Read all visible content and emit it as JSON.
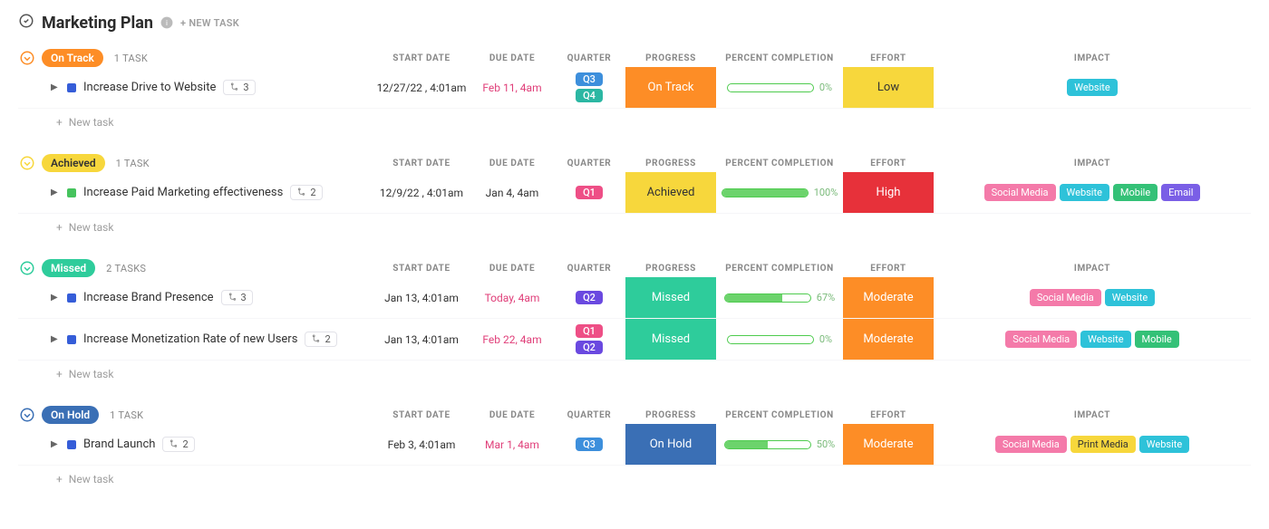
{
  "header": {
    "title": "Marketing Plan",
    "new_task_label": "+ NEW TASK"
  },
  "columns": {
    "start_date": "START DATE",
    "due_date": "DUE DATE",
    "quarter": "QUARTER",
    "progress": "PROGRESS",
    "percent": "PERCENT COMPLETION",
    "effort": "EFFORT",
    "impact": "IMPACT"
  },
  "colors": {
    "status": {
      "On Track": "#fd8d26",
      "Achieved": "#f7d73c",
      "Missed": "#2ecc9b",
      "On Hold": "#3a6fb5"
    },
    "status_text_dark": [
      "Achieved"
    ],
    "group_pill": {
      "On Track": "#fd8d26",
      "Achieved": "#f7d73c",
      "Missed": "#2ecc9b",
      "On Hold": "#3a6fb5"
    },
    "group_pill_text_dark": [
      "Achieved"
    ],
    "group_collapse": {
      "On Track": "#fd8d26",
      "Achieved": "#f7d73c",
      "Missed": "#2ecc9b",
      "On Hold": "#3a6fb5"
    },
    "effort": {
      "Low": "#f7d73c",
      "Moderate": "#fd8d26",
      "High": "#e7313a"
    },
    "effort_text_dark": [
      "Low"
    ],
    "quarter": {
      "Q1": "#ee4f86",
      "Q2": "#6a49e0",
      "Q3": "#3d8fdc",
      "Q4": "#2bb7a3"
    },
    "impact": {
      "Website": "#2ec2d9",
      "Social Media": "#f47aa9",
      "Mobile": "#34c177",
      "Email": "#7a5fe6",
      "Print Media": "#f7d73c"
    },
    "impact_text_dark": [
      "Print Media"
    ],
    "task_dot": {
      "blue": "#355dd8",
      "green": "#45c35d"
    }
  },
  "new_task_row_label": "+ New task",
  "groups": [
    {
      "name": "On Track",
      "count_label": "1 TASK",
      "tasks": [
        {
          "name": "Increase Drive to Website",
          "dot": "blue",
          "subtasks": 3,
          "start_date": "12/27/22 , 4:01am",
          "due_date": "Feb 11, 4am",
          "due_late": true,
          "quarters": [
            "Q3",
            "Q4"
          ],
          "progress": "On Track",
          "percent": 0,
          "effort": "Low",
          "impact": [
            "Website"
          ]
        }
      ]
    },
    {
      "name": "Achieved",
      "count_label": "1 TASK",
      "tasks": [
        {
          "name": "Increase Paid Marketing effectiveness",
          "dot": "green",
          "subtasks": 2,
          "start_date": "12/9/22 , 4:01am",
          "due_date": "Jan 4, 4am",
          "due_late": false,
          "quarters": [
            "Q1"
          ],
          "progress": "Achieved",
          "percent": 100,
          "effort": "High",
          "impact": [
            "Social Media",
            "Website",
            "Mobile",
            "Email"
          ]
        }
      ]
    },
    {
      "name": "Missed",
      "count_label": "2 TASKS",
      "tasks": [
        {
          "name": "Increase Brand Presence",
          "dot": "blue",
          "subtasks": 3,
          "start_date": "Jan 13, 4:01am",
          "due_date": "Today, 4am",
          "due_late": true,
          "quarters": [
            "Q2"
          ],
          "progress": "Missed",
          "percent": 67,
          "effort": "Moderate",
          "impact": [
            "Social Media",
            "Website"
          ]
        },
        {
          "name": "Increase Monetization Rate of new Users",
          "dot": "blue",
          "subtasks": 2,
          "start_date": "Jan 13, 4:01am",
          "due_date": "Feb 22, 4am",
          "due_late": true,
          "quarters": [
            "Q1",
            "Q2"
          ],
          "progress": "Missed",
          "percent": 0,
          "effort": "Moderate",
          "impact": [
            "Social Media",
            "Website",
            "Mobile"
          ]
        }
      ]
    },
    {
      "name": "On Hold",
      "count_label": "1 TASK",
      "tasks": [
        {
          "name": "Brand Launch",
          "dot": "blue",
          "subtasks": 2,
          "start_date": "Feb 3, 4:01am",
          "due_date": "Mar 1, 4am",
          "due_late": true,
          "quarters": [
            "Q3"
          ],
          "progress": "On Hold",
          "percent": 50,
          "effort": "Moderate",
          "impact": [
            "Social Media",
            "Print Media",
            "Website"
          ]
        }
      ]
    }
  ]
}
